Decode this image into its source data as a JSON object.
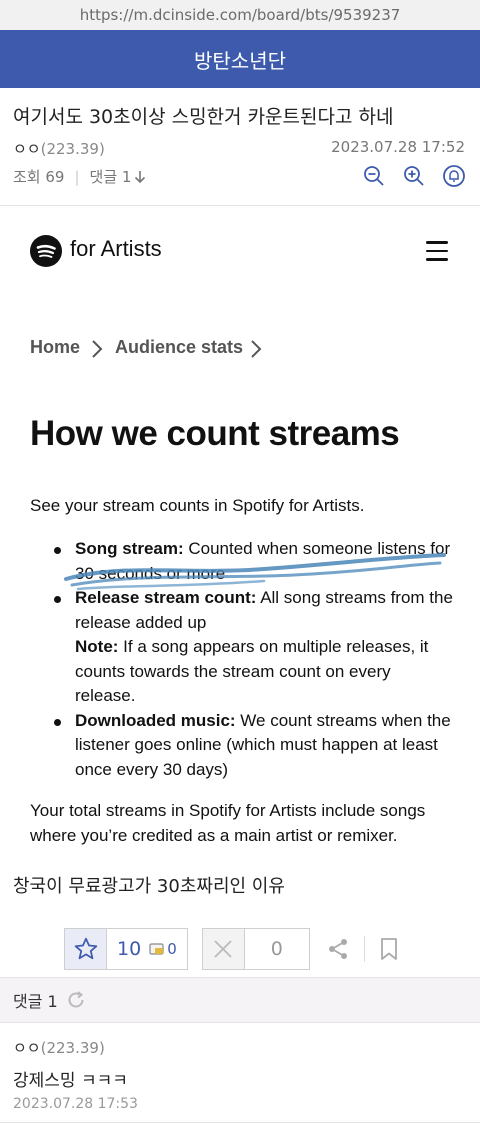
{
  "browser": {
    "url": "https://m.dcinside.com/board/bts/9539237"
  },
  "board": {
    "title": "방탄소년단"
  },
  "post": {
    "title": "여기서도 30초이상 스밍한거 카운트된다고 하네",
    "author": "ㅇㅇ",
    "author_ip": "(223.39)",
    "date": "2023.07.28 17:52",
    "views_label": "조회 69",
    "comments_label": "댓글 1",
    "caption": "창국이 무료광고가 30초짜리인 이유"
  },
  "embed": {
    "brand": "for Artists",
    "breadcrumb": {
      "home": "Home",
      "current": "Audience stats"
    },
    "heading": "How we count streams",
    "intro": "See your stream counts in Spotify for Artists.",
    "bullets": [
      {
        "label": "Song stream:",
        "text": " Counted when someone listens for 30 seconds or more"
      },
      {
        "label": "Release stream count:",
        "text": " All song streams from the release added up",
        "note_label": "Note:",
        "note": " If a song appears on multiple releases, it counts towards the stream count on every release."
      },
      {
        "label": "Downloaded music:",
        "text": " We count streams when the listener goes online (which must happen at least once every 30 days)"
      }
    ],
    "outro": "Your total streams in Spotify for Artists include songs where you’re credited as a main artist or remixer.",
    "highlight_color": "#4a86b8"
  },
  "actions": {
    "recommend_count": "10",
    "fixed_recommend_count": "0",
    "downvote_count": "0"
  },
  "comments": {
    "header": "댓글 1",
    "items": [
      {
        "author": "ㅇㅇ",
        "ip": "(223.39)",
        "text": "강제스밍 ㅋㅋㅋ",
        "date": "2023.07.28 17:53"
      }
    ]
  },
  "colors": {
    "brand": "#3d5aad"
  }
}
